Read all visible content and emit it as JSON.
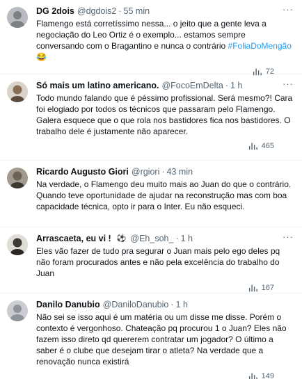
{
  "tweets": [
    {
      "name": "DG 2dois",
      "handle": "@dgdois2",
      "dot": "·",
      "time": "55 min",
      "text": "Flamengo está corretíssimo nessa... o jeito que a gente leva a negociação do Leo Ortiz é o exemplo... estamos sempre conversando com o Bragantino e nunca o contrário",
      "hashtag": "#FoliaDoMengão",
      "emoji": "😂",
      "views": "72",
      "avatar_color": "#b8bcc0"
    },
    {
      "name": "Só mais um latino americano.",
      "handle": "@FocoEmDelta",
      "dot": "·",
      "time": "1 h",
      "text": "Todo mundo falando que é péssimo profissional. Será mesmo?! Cara foi elogiado por todos os técnicos que passaram pelo Flamengo. Galera esquece que o que rola nos bastidores fica nos bastidores. O trabalho dele é justamente não aparecer.",
      "views": "465",
      "avatar_color": "#8a6d55"
    },
    {
      "name": "Ricardo Augusto Giori",
      "handle": "@rgiori",
      "dot": "·",
      "time": "43 min",
      "text": "Na verdade, o Flamengo deu muito mais ao Juan do que o contrário. Quando teve oportunidade de ajudar na reconstrução mas com boa capacidade técnica, opto ir para o Inter. Eu não esqueci.",
      "views": "",
      "avatar_color": "#6e6254"
    },
    {
      "name": "Arrascaeta, eu vi !",
      "name_emoji": "⚽",
      "handle": "@Eh_soh_",
      "dot": "·",
      "time": "1 h",
      "text": "Eles vão fazer de tudo pra segurar o Juan mais pelo ego deles pq não foram procurados antes e não pela excelência do trabalho do Juan",
      "views": "167",
      "avatar_color": "#3f3a35"
    },
    {
      "name": "Danilo Danubio",
      "handle": "@DaniloDanubio",
      "dot": "·",
      "time": "1 h",
      "text": "Não sei se isso aqui é um matéria ou um disse me disse. Porém o contexto é vergonhoso.   Chateação pq procurou 1 o Juan? Eles não fazem isso direto qd quererem contratar um jogador? O último a saber é o clube que desejam tirar o atleta? Na verdade que a renovação nunca existirá",
      "views": "149",
      "avatar_color": "#c9ccd0"
    }
  ],
  "more_glyph": "···"
}
